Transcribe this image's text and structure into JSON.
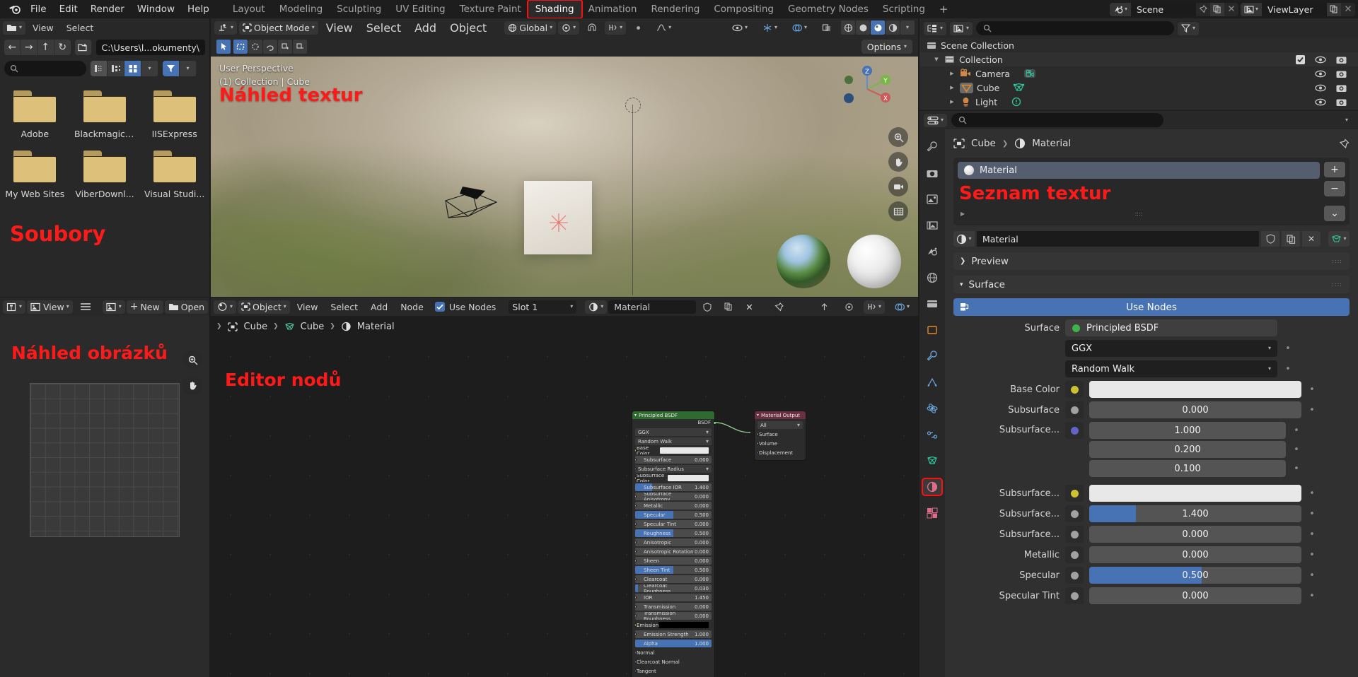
{
  "topbar": {
    "logo_icon": "blender-logo-icon",
    "menus": [
      "File",
      "Edit",
      "Render",
      "Window",
      "Help"
    ],
    "workspaces": [
      {
        "label": "Layout",
        "active": false
      },
      {
        "label": "Modeling",
        "active": false
      },
      {
        "label": "Sculpting",
        "active": false
      },
      {
        "label": "UV Editing",
        "active": false
      },
      {
        "label": "Texture Paint",
        "active": false
      },
      {
        "label": "Shading",
        "active": true,
        "highlighted": true
      },
      {
        "label": "Animation",
        "active": false
      },
      {
        "label": "Rendering",
        "active": false
      },
      {
        "label": "Compositing",
        "active": false
      },
      {
        "label": "Geometry Nodes",
        "active": false
      },
      {
        "label": "Scripting",
        "active": false
      }
    ],
    "add_workspace_label": "+",
    "scene": {
      "name": "Scene",
      "icon": "scene-icon",
      "pin_icon": "pin-icon",
      "copy_icon": "copy-icon",
      "close_icon": "close-icon"
    },
    "viewlayer": {
      "name": "ViewLayer",
      "icon": "viewlayer-icon",
      "copy_icon": "copy-icon",
      "close_icon": "close-icon"
    }
  },
  "file_browser": {
    "editor_icon": "file-browser-icon",
    "menus": [
      "View",
      "Select"
    ],
    "nav": {
      "back": "←",
      "forward": "→",
      "up": "↑",
      "refresh": "↻",
      "new_folder_icon": "new-folder-icon"
    },
    "path": "C:\\Users\\l...okumenty\\",
    "search_placeholder": "",
    "display_modes": [
      "vertical-list-icon",
      "horizontal-list-icon",
      "thumbnail-grid-icon"
    ],
    "filter_icon": "filter-icon",
    "overlay_label": "Soubory",
    "folders": [
      "Adobe",
      "Blackmagic ...",
      "IISExpress",
      "My Web Sites",
      "ViberDownl...",
      "Visual Studi..."
    ]
  },
  "viewport": {
    "editor_icon": "viewport-icon",
    "mode": "Object Mode",
    "menus": [
      "View",
      "Select",
      "Add",
      "Object"
    ],
    "transform_orientation": "Global",
    "snap_icon": "magnet-icon",
    "proportional_icon": "proportional-edit-icon",
    "options_label": "Options",
    "info_line1": "User Perspective",
    "info_line2": "(1) Collection | Cube",
    "overlay_label": "Náhled textur",
    "gizmo_axes": [
      "X",
      "Y",
      "Z"
    ],
    "side_tools": [
      "zoom-icon",
      "pan-hand-icon",
      "camera-view-icon",
      "orthographic-icon"
    ]
  },
  "image_editor": {
    "editor_icon": "image-editor-icon",
    "mode_icon": "uv-editor-icon",
    "view_menu": "View",
    "menu_icon": "hamburger-icon",
    "image_icon": "image-icon",
    "new_label": "New",
    "open_label": "Open",
    "overlay_label": "Náhled obrázků",
    "side_tools": [
      "zoom-icon",
      "pan-hand-icon"
    ]
  },
  "node_editor": {
    "editor_icon": "shader-editor-icon",
    "shader_type": "Object",
    "menus": [
      "View",
      "Select",
      "Add",
      "Node"
    ],
    "use_nodes_label": "Use Nodes",
    "use_nodes_checked": true,
    "slot": "Slot 1",
    "material_icon": "material-icon",
    "material_name": "Material",
    "material_shield_icon": "fake-user-icon",
    "material_copy_icon": "copy-icon",
    "material_close_icon": "close-icon",
    "pin_icon": "pin-icon",
    "breadcrumb": [
      "Cube",
      "Cube",
      "Material"
    ],
    "overlay_label": "Editor nodů",
    "nodes": [
      {
        "name": "Principled BSDF",
        "header_color": "#2f6b2f",
        "output_socket": "BSDF",
        "rows": [
          {
            "label": "GGX",
            "type": "dropdown"
          },
          {
            "label": "Random Walk",
            "type": "dropdown"
          },
          {
            "label": "Base Color",
            "value": "",
            "type": "color",
            "color": "#e8e8e8",
            "socket": "#ccc133"
          },
          {
            "label": "Subsurface",
            "value": "0.000",
            "type": "slider",
            "fill": 0,
            "socket": "#a1a1a1"
          },
          {
            "label": "Subsurface Radius",
            "type": "dropdown",
            "socket": "#6363c7"
          },
          {
            "label": "Subsurface Color",
            "value": "",
            "type": "color",
            "color": "#e8e8e8",
            "socket": "#ccc133"
          },
          {
            "label": "Subsurface IOR",
            "value": "1.400",
            "type": "slider",
            "fill": 22,
            "socket": "#a1a1a1"
          },
          {
            "label": "Subsurface Anisotropy",
            "value": "0.000",
            "type": "slider",
            "fill": 0,
            "socket": "#a1a1a1"
          },
          {
            "label": "Metallic",
            "value": "0.000",
            "type": "slider",
            "fill": 0,
            "socket": "#a1a1a1"
          },
          {
            "label": "Specular",
            "value": "0.500",
            "type": "slider",
            "fill": 50,
            "socket": "#a1a1a1"
          },
          {
            "label": "Specular Tint",
            "value": "0.000",
            "type": "slider",
            "fill": 0,
            "socket": "#a1a1a1"
          },
          {
            "label": "Roughness",
            "value": "0.500",
            "type": "slider",
            "fill": 50,
            "socket": "#a1a1a1"
          },
          {
            "label": "Anisotropic",
            "value": "0.000",
            "type": "slider",
            "fill": 0,
            "socket": "#a1a1a1"
          },
          {
            "label": "Anisotropic Rotation",
            "value": "0.000",
            "type": "slider",
            "fill": 0,
            "socket": "#a1a1a1"
          },
          {
            "label": "Sheen",
            "value": "0.000",
            "type": "slider",
            "fill": 0,
            "socket": "#a1a1a1"
          },
          {
            "label": "Sheen Tint",
            "value": "0.500",
            "type": "slider",
            "fill": 50,
            "socket": "#a1a1a1"
          },
          {
            "label": "Clearcoat",
            "value": "0.000",
            "type": "slider",
            "fill": 0,
            "socket": "#a1a1a1"
          },
          {
            "label": "Clearcoat Roughness",
            "value": "0.030",
            "type": "slider",
            "fill": 3,
            "socket": "#a1a1a1"
          },
          {
            "label": "IOR",
            "value": "1.450",
            "type": "slider",
            "fill": 0,
            "socket": "#a1a1a1"
          },
          {
            "label": "Transmission",
            "value": "0.000",
            "type": "slider",
            "fill": 0,
            "socket": "#a1a1a1"
          },
          {
            "label": "Transmission Roughness",
            "value": "0.000",
            "type": "slider",
            "fill": 0,
            "socket": "#a1a1a1"
          },
          {
            "label": "Emission",
            "value": "",
            "type": "color",
            "color": "#000000",
            "socket": "#ccc133"
          },
          {
            "label": "Emission Strength",
            "value": "1.000",
            "type": "slider",
            "fill": 0,
            "socket": "#a1a1a1"
          },
          {
            "label": "Alpha",
            "value": "1.000",
            "type": "slider",
            "fill": 100,
            "socket": "#a1a1a1"
          },
          {
            "label": "Normal",
            "type": "socket-only",
            "socket": "#6363c7"
          },
          {
            "label": "Clearcoat Normal",
            "type": "socket-only",
            "socket": "#6363c7"
          },
          {
            "label": "Tangent",
            "type": "socket-only",
            "socket": "#6363c7"
          }
        ]
      },
      {
        "name": "Material Output",
        "header_color": "#6b3040",
        "rows": [
          {
            "label": "All",
            "type": "dropdown"
          },
          {
            "label": "Surface",
            "type": "socket-only",
            "socket": "#8ecb8e"
          },
          {
            "label": "Volume",
            "type": "socket-only",
            "socket": "#8ecb8e"
          },
          {
            "label": "Displacement",
            "type": "socket-only",
            "socket": "#6363c7"
          }
        ]
      }
    ]
  },
  "outliner": {
    "display_mode_icon": "outliner-display-icon",
    "filter_id_icon": "id-type-icon",
    "search_placeholder": "",
    "filter_icon": "filter-icon",
    "rows": [
      {
        "label": "Scene Collection",
        "icon": "collection-icon",
        "depth": 0,
        "expand": "",
        "has_toggles": false
      },
      {
        "label": "Collection",
        "icon": "collection-icon",
        "depth": 1,
        "expand": "▼",
        "has_toggles": true,
        "checkbox": true
      },
      {
        "label": "Camera",
        "icon": "camera-icon",
        "depth": 2,
        "expand": "▶",
        "has_toggles": true,
        "data_icon": "camera-data-icon"
      },
      {
        "label": "Cube",
        "icon": "mesh-icon",
        "depth": 2,
        "expand": "▶",
        "has_toggles": true,
        "data_icon": "mesh-data-icon"
      },
      {
        "label": "Light",
        "icon": "light-icon",
        "depth": 2,
        "expand": "▶",
        "has_toggles": true,
        "data_icon": "light-data-icon"
      }
    ]
  },
  "properties": {
    "editor_icon": "properties-icon",
    "search_placeholder": "",
    "tabs": [
      "tool-icon",
      "render-icon",
      "output-icon",
      "viewlayer-icon",
      "scene-icon",
      "world-icon",
      "collection-icon",
      "object-icon",
      "modifier-icon",
      "particles-icon",
      "physics-icon",
      "constraints-icon",
      "data-icon",
      "material-icon",
      "texture-icon"
    ],
    "active_tab_index": 13,
    "highlighted_tab_index": 13,
    "breadcrumb": [
      "Cube",
      "Material"
    ],
    "pin_icon": "pin-icon",
    "material_slot": "Material",
    "slot_overlay_label": "Seznam textur",
    "add_slot": "+",
    "remove_slot": "−",
    "specials_menu": "⌄",
    "material_name": "Material",
    "panels": [
      {
        "label": "Preview",
        "expanded": false
      },
      {
        "label": "Surface",
        "expanded": true
      }
    ],
    "use_nodes_label": "Use Nodes",
    "fields": [
      {
        "label": "Surface",
        "value": "Principled BSDF",
        "type": "node-ref",
        "dot": "#3eb34a"
      },
      {
        "label": "",
        "value": "GGX",
        "type": "dropdown"
      },
      {
        "label": "",
        "value": "Random Walk",
        "type": "dropdown"
      },
      {
        "label": "Base Color",
        "value": "",
        "type": "color",
        "color": "#e8e8e8",
        "dot": "#ccc133"
      },
      {
        "label": "Subsurface",
        "value": "0.000",
        "type": "slider",
        "fill": 0,
        "dot": "#a1a1a1"
      },
      {
        "label": "Subsurface...",
        "value": "1.000",
        "type": "vector",
        "extra": [
          "0.200",
          "0.100"
        ],
        "dot": "#6363c7"
      },
      {
        "label": "Subsurface...",
        "value": "",
        "type": "color",
        "color": "#e8e8e8",
        "dot": "#ccc133"
      },
      {
        "label": "Subsurface...",
        "value": "1.400",
        "type": "slider",
        "fill": 22,
        "dot": "#a1a1a1"
      },
      {
        "label": "Subsurface...",
        "value": "0.000",
        "type": "slider",
        "fill": 0,
        "dot": "#a1a1a1"
      },
      {
        "label": "Metallic",
        "value": "0.000",
        "type": "slider",
        "fill": 0,
        "dot": "#a1a1a1"
      },
      {
        "label": "Specular",
        "value": "0.500",
        "type": "slider",
        "fill": 50,
        "dot": "#a1a1a1"
      },
      {
        "label": "Specular Tint",
        "value": "0.000",
        "type": "slider",
        "fill": 0,
        "dot": "#a1a1a1"
      }
    ]
  },
  "colors": {
    "accent_blue": "#4772b3",
    "annotation_red": "#ff1a1a",
    "header_bg": "#282828",
    "editor_bg": "#303030",
    "node_bg": "#1d1d1d"
  }
}
